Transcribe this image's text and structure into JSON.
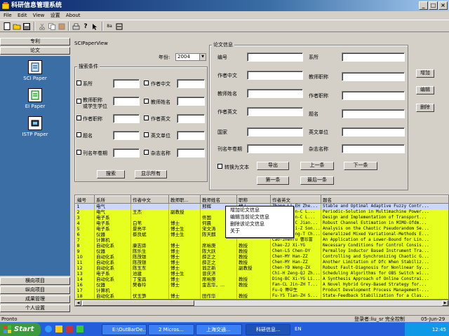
{
  "window": {
    "title": "科研信息管理系统"
  },
  "menu": [
    "File",
    "Edit",
    "View",
    "设置",
    "About"
  ],
  "nav": {
    "top_buttons": [
      "专利",
      "论文"
    ],
    "items": [
      "SCI Paper",
      "EI Paper",
      "ISTP Paper"
    ],
    "bottom_buttons": [
      "横向项目",
      "纵向项目",
      "成果管理",
      "个人设置"
    ]
  },
  "form": {
    "view_title": "SCIPaperView",
    "year_label": "年份:",
    "year_value": "2004",
    "search_group": "搜索条件",
    "search_left": [
      "系所",
      "教师职称\n或学生学位",
      "作者职称",
      "题名",
      "刊名年卷期"
    ],
    "search_right": [
      "作者中文",
      "教师姓名",
      "作者英文",
      "英文单位",
      "杂志名称"
    ],
    "search_button": "搜索",
    "show_all_button": "显示所有",
    "info_group": "论文信息",
    "info_left": [
      "编号",
      "作者中文",
      "教师姓名",
      "作者英文",
      "国家",
      "刊名年卷期"
    ],
    "info_right": [
      "系所",
      "教师职称",
      "作者职称",
      "题名",
      "英文单位",
      "杂志名称"
    ],
    "convert_label": "转换为文本",
    "export_button": "导出",
    "prev_button": "上一条",
    "next_button": "下一条",
    "first_button": "第一条",
    "last_button": "最后一条",
    "add_button": "增加",
    "edit_button": "编辑",
    "delete_button": "删除"
  },
  "grid": {
    "headers": [
      "编号",
      "系所",
      "作者中文",
      "教师职...",
      "教师姓名",
      "职称",
      "作者英文",
      "题名"
    ],
    "rows": [
      [
        "1",
        "电气",
        "",
        "",
        "邢辉",
        "博士",
        "Zhang Li-EH Zhe...",
        "Stable and Optimal Adaptive Fuzzy Contr..."
      ],
      [
        "2",
        "电气",
        "王杰",
        "副教授",
        "",
        "",
        "Ren-J Chen-C L...",
        "Periodic-Solution in Multimachine Power..."
      ],
      [
        "3",
        "电子系",
        "",
        "",
        "佟国",
        "",
        "Zhu-J Chen-C L...",
        "Design and Implementation of Transport..."
      ],
      [
        "4",
        "电子系",
        "白苇",
        "博士",
        "何晨",
        "",
        "Lv-ZM He-C Jian...",
        "Robust Channel Estimation in MIMO-Ofdm..."
      ],
      [
        "5",
        "电子系",
        "景亮平",
        "博士生",
        "宋文涛",
        "",
        "Jing-LP Li-Z Son...",
        "Analysis on the Chaotic Pseudorandom Se..."
      ],
      [
        "6",
        "仪器",
        "蔡良斌",
        "博士生",
        "陈天麒",
        "",
        "Cai-LB Feng-T Ch...",
        "Generalized Mixed Variational-Methods E..."
      ],
      [
        "7",
        "计算机",
        "",
        "",
        "",
        "",
        "Cao-zhenfu 曹珍富",
        "An Application of a Lower-Bound for Lin..."
      ],
      [
        "8",
        "自动化系",
        "康志骅",
        "博士",
        "席裕庚",
        "教授",
        "Chao-ZJ Xi-YG",
        "Necessary Conditions for Control Consis..."
      ],
      [
        "9",
        "仪器",
        "陈乐生",
        "博士",
        "陈大跃",
        "教授",
        "Chen-LS Chen-DY",
        "Permalloy Inductor Based Instrument Tra..."
      ],
      [
        "10",
        "自动化系",
        "陈茂银",
        "博士",
        "薛正之",
        "教授",
        "Chen-MY Han-ZZ",
        "Controlling and Synchronizing Chaotic G..."
      ],
      [
        "11",
        "自动化系",
        "陈茂银",
        "博士",
        "薛正之",
        "教授",
        "Chen-MY Han-ZZ",
        "Another Limitation of Dfc When Stabiliz..."
      ],
      [
        "12",
        "自动化系",
        "陈玉东",
        "博士",
        "翁正新",
        "副教授",
        "Chen-YD Weng-ZX",
        "Robust Fault-Diagnosis for Nonlinear Sy..."
      ],
      [
        "13",
        "电子系",
        "池建",
        "博士生",
        "曾庆济",
        "",
        "Chi-H Zeng-QJ Zh...",
        "Scheduling Algorithms for OBS Switch wi..."
      ],
      [
        "14",
        "自动化系",
        "丁宝昌",
        "博士",
        "席裕庚",
        "教授",
        "Ding-BC Xi-YG Li...",
        "A Synthesis Approach of Online Constrai..."
      ],
      [
        "16",
        "仪器",
        "樊春玲",
        "博士",
        "金志华，...",
        "教授",
        "Fan-CL Jin-ZH T...",
        "A Novel Hybrid Grey-Based Strategy for..."
      ],
      [
        "17",
        "计算机",
        "",
        "",
        "",
        "",
        "Fu-Q 傅中生",
        "Product Development Process Management-..."
      ],
      [
        "18",
        "自动化系",
        "伏玉笋",
        "博士",
        "田作华",
        "教授",
        "Fu-YS Tian-ZH S...",
        "State-Feedback Stabilization for a Clas..."
      ]
    ]
  },
  "context_menu": [
    "增加论文信息",
    "编辑当前论文信息",
    "删除该论文信息",
    "关于"
  ],
  "status": {
    "left": "Pronto",
    "right": "登录者:liu_sr 完全控制",
    "date": "05-Jun-29"
  },
  "taskbar": {
    "start": "Start",
    "tasks": [
      "E:\\OutBarDe...",
      "2 Micros...",
      "上海交通...",
      "科研信息..."
    ],
    "lang": "EN",
    "clock": "12:45"
  }
}
